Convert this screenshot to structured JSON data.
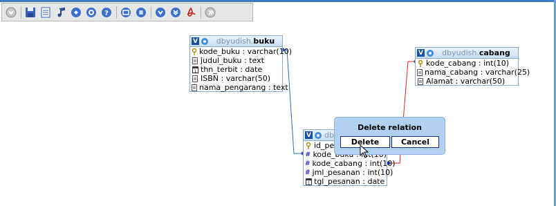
{
  "toolbar": {
    "icons": [
      "collapse-icon",
      "save-icon",
      "page-icon",
      "music-note-icon",
      "circle-icon-1",
      "circle-icon-2",
      "help-icon",
      "table-icon",
      "grid-icon",
      "arrow-down-icon",
      "arrow-down-icon-2",
      "pdf-icon",
      "expand-icon"
    ]
  },
  "tables": {
    "buku": {
      "db": "dbyudish.",
      "name": "buku",
      "fields": [
        "kode_buku : varchar(10)",
        "judul_buku : text",
        "thn_terbit : date",
        "ISBN : varchar(50)",
        "nama_pengarang : text"
      ]
    },
    "cabang": {
      "db": "dbyudish.",
      "name": "cabang",
      "fields": [
        "kode_cabang : int(10)",
        "nama_cabang : varchar(25)",
        "Alamat : varchar(50)"
      ]
    },
    "pesanan": {
      "db": "dby",
      "fields": [
        "id_pes",
        "kode_buku : int(10)",
        "kode_cabang : int(10)",
        "jml_pesanan : int(10)",
        "tgl_pesanan : date"
      ]
    }
  },
  "dialog": {
    "title": "Delete relation",
    "delete_label": "Delete",
    "cancel_label": "Cancel"
  },
  "colors": {
    "relation_blue": "#2a6db0",
    "relation_red": "#e02020",
    "dialog_bg": "#b2d0f0",
    "table_header": "#c9def4"
  }
}
